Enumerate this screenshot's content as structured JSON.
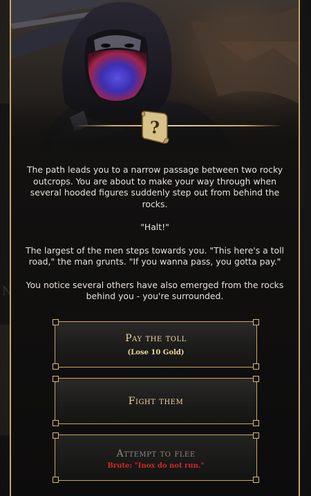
{
  "event": {
    "paragraphs": [
      "The path leads you to a narrow passage between two rocky outcrops. You are about to make your way through when several hooded figures suddenly step out from behind the rocks.",
      "\"Halt!\"",
      "The largest of the men steps towards you. \"This here's a toll road,\" the man grunts. \"If you wanna pass, you gotta pay.\"",
      "You notice several others have also emerged from the rocks behind you - you're surrounded."
    ],
    "icon": "quest-scroll-icon"
  },
  "background": {
    "ghost_text": "IN"
  },
  "choices": [
    {
      "label": "Pay the toll",
      "sub": "(Lose 10 Gold)",
      "enabled": true
    },
    {
      "label": "Fight them",
      "sub": "",
      "enabled": true
    },
    {
      "label": "Attempt to flee",
      "sub": "Brute: \"Inox do not run.\"",
      "enabled": false
    }
  ],
  "colors": {
    "gold_accent": "#c9a95b",
    "choice_text": "#f0d79a",
    "disabled_text": "#8e8a84",
    "warning_text": "#d22a22",
    "body_text": "#e6e2da"
  }
}
